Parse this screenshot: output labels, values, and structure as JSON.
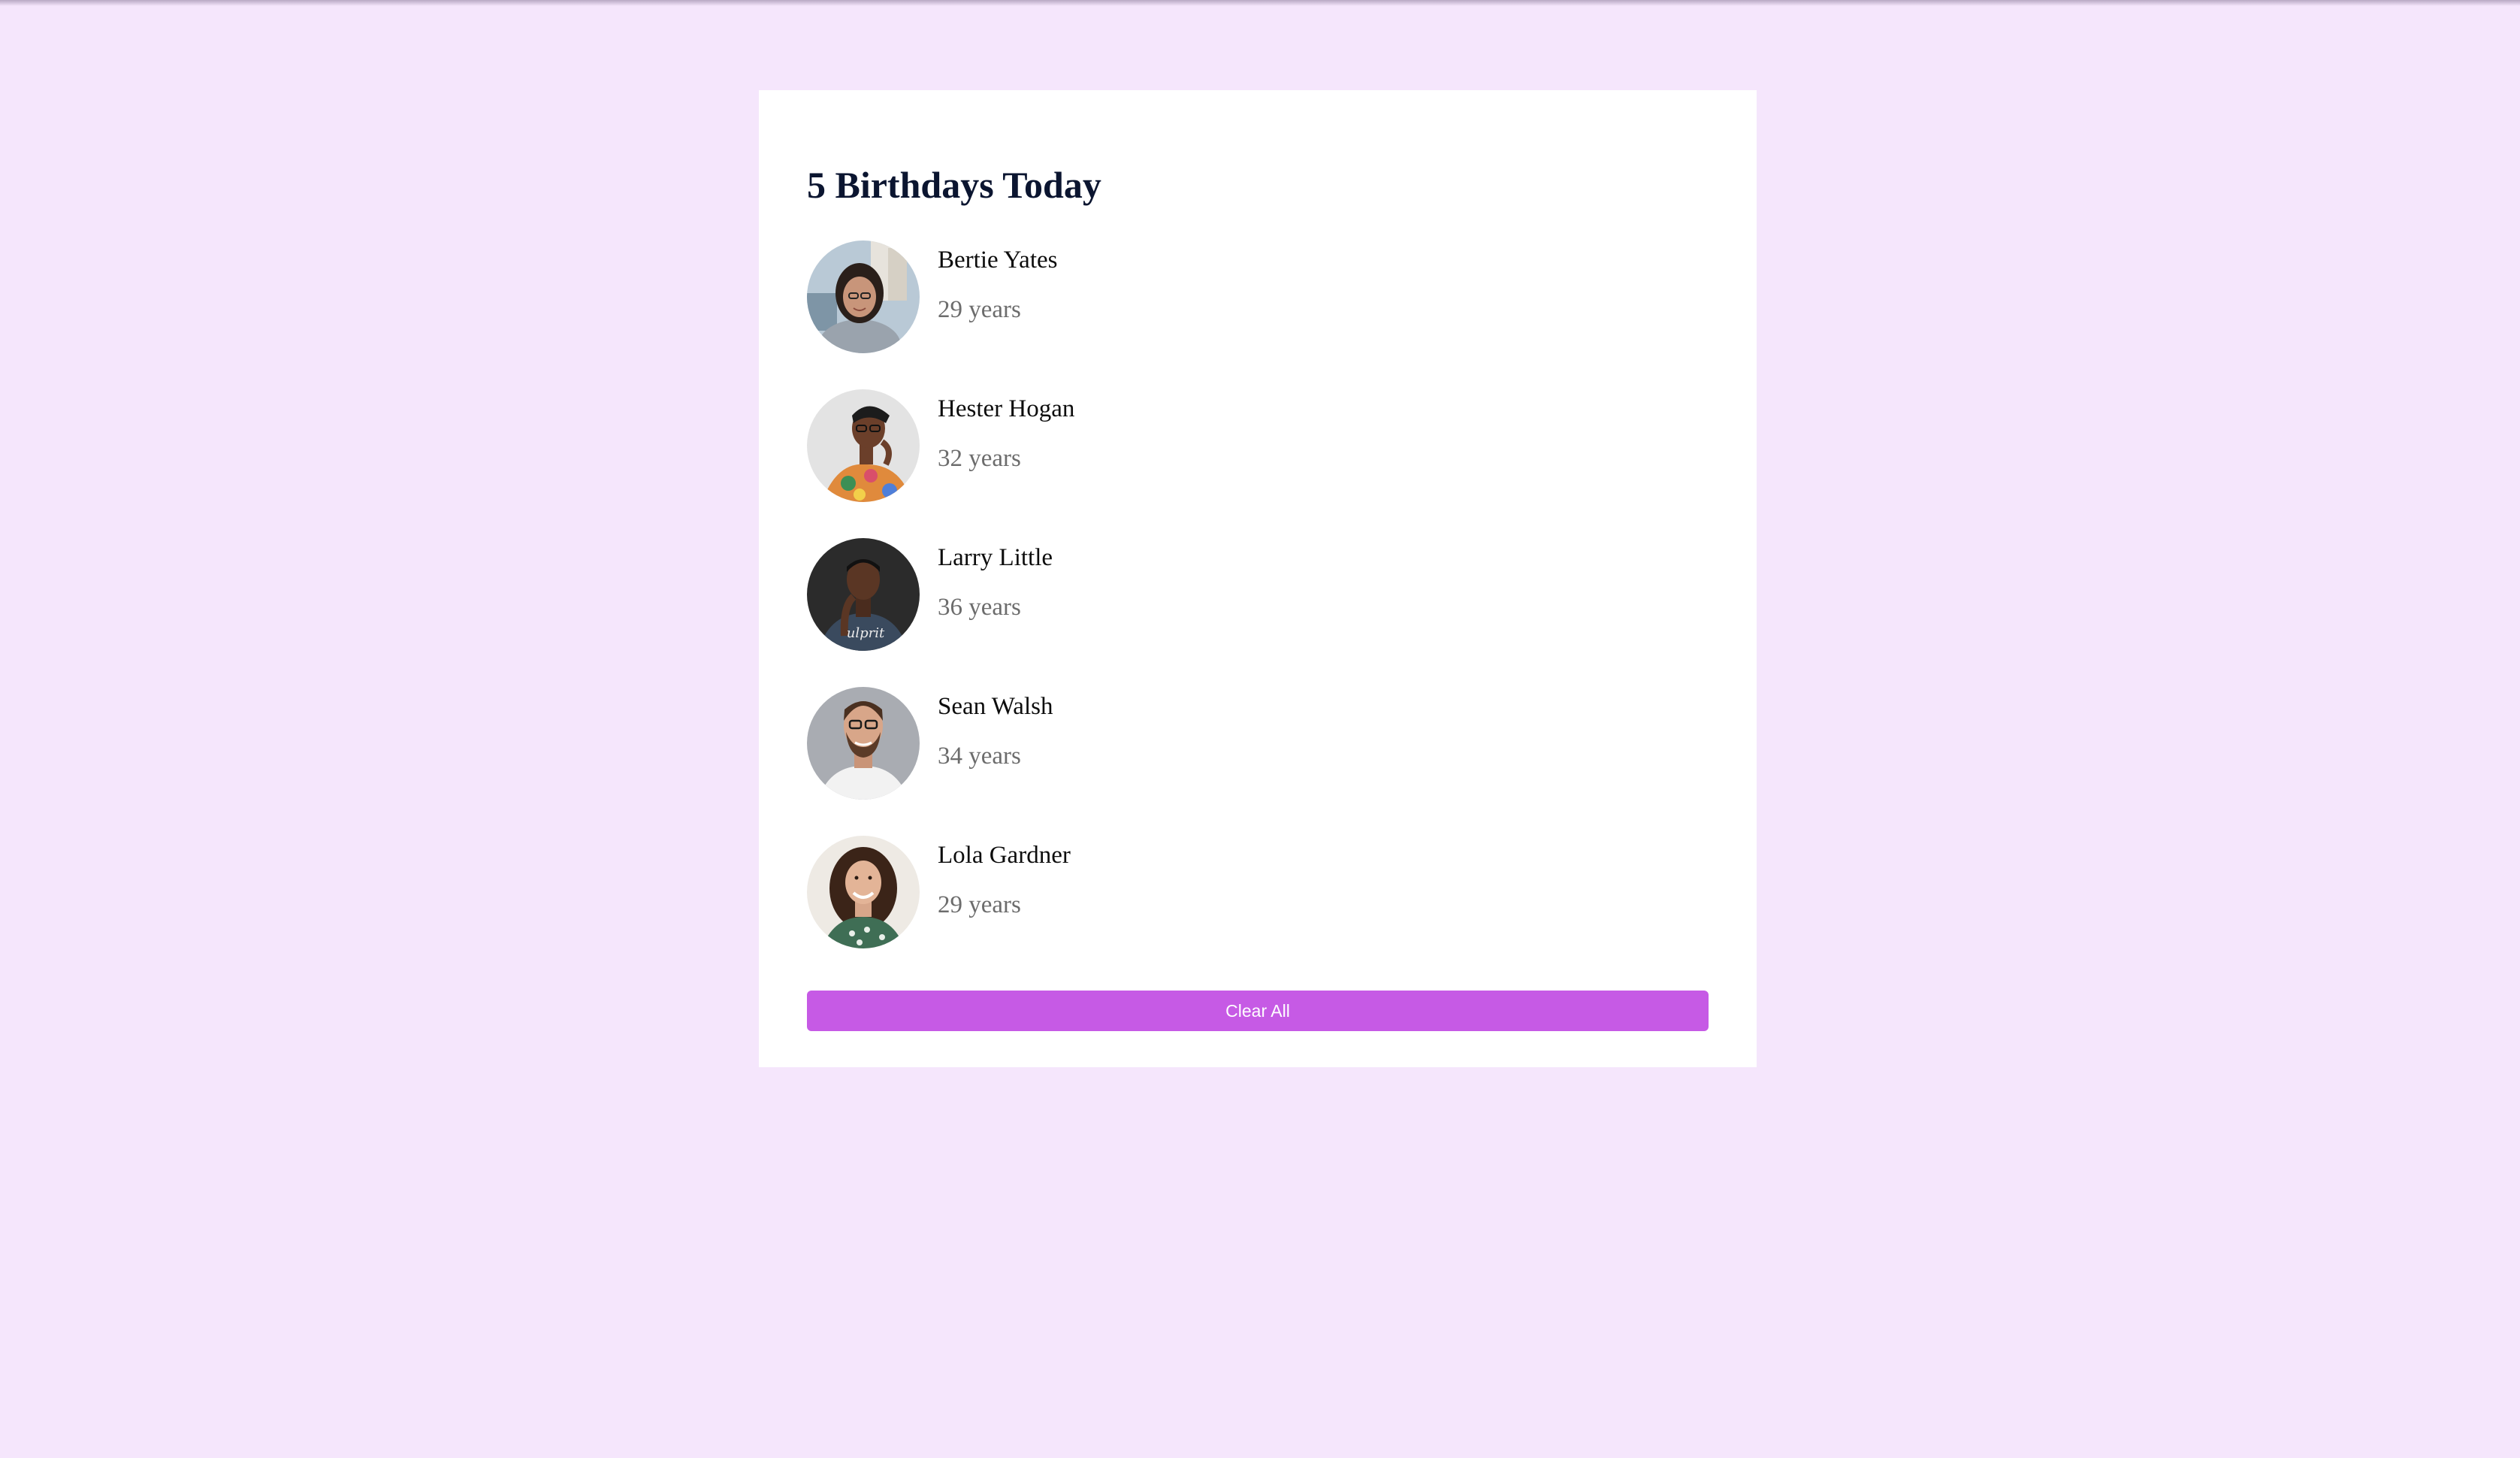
{
  "header": {
    "title": "5 Birthdays Today"
  },
  "people": [
    {
      "name": "Bertie Yates",
      "age": "29 years",
      "avatar_icon": "woman-with-glasses-photo"
    },
    {
      "name": "Hester Hogan",
      "age": "32 years",
      "avatar_icon": "woman-floral-shirt-photo"
    },
    {
      "name": "Larry Little",
      "age": "36 years",
      "avatar_icon": "man-dark-background-photo"
    },
    {
      "name": "Sean Walsh",
      "age": "34 years",
      "avatar_icon": "man-with-glasses-photo"
    },
    {
      "name": "Lola Gardner",
      "age": "29 years",
      "avatar_icon": "woman-curly-hair-photo"
    }
  ],
  "actions": {
    "clear_label": "Clear All"
  },
  "colors": {
    "page_background": "#f5e6fc",
    "card_background": "#ffffff",
    "accent": "#c65ae5",
    "title": "#0b1530",
    "secondary_text": "#6c6c6c"
  }
}
